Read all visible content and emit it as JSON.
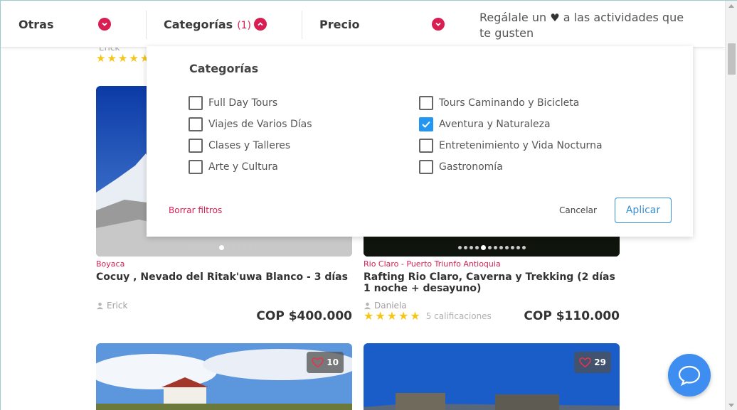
{
  "filters": {
    "others_label": "Otras",
    "categories_label": "Categorías",
    "categories_count": "(1)",
    "price_label": "Precio",
    "gift_text_before": "Regálale un",
    "gift_text_after": "a las actividades que te gusten"
  },
  "dropdown": {
    "title": "Categorías",
    "options_left": [
      {
        "label": "Full Day Tours",
        "checked": false
      },
      {
        "label": "Viajes de Varios Días",
        "checked": false
      },
      {
        "label": "Clases y Talleres",
        "checked": false
      },
      {
        "label": "Arte y Cultura",
        "checked": false
      }
    ],
    "options_right": [
      {
        "label": "Tours Caminando y Bicicleta",
        "checked": false
      },
      {
        "label": "Aventura y Naturaleza",
        "checked": true
      },
      {
        "label": "Entretenimiento y Vida Nocturna",
        "checked": false
      },
      {
        "label": "Gastronomía",
        "checked": false
      }
    ],
    "clear_label": "Borrar filtros",
    "cancel_label": "Cancelar",
    "apply_label": "Aplicar"
  },
  "peek": {
    "author": "Erick"
  },
  "cards": [
    {
      "location": "Boyaca",
      "title": "Cocuy , Nevado del Ritak'uwa Blanco - 3 días",
      "author": "Erick",
      "price": "COP $400.000",
      "dots": 12,
      "active_dot": 5
    },
    {
      "location": "Rio Claro - Puerto Triunfo Antioquia",
      "title": "Rafting Rio Claro, Caverna y Trekking (2 días 1 noche + desayuno)",
      "author": "Daniela",
      "ratings": "5 calificaciones",
      "stars": 5,
      "price": "COP $110.000",
      "dots": 12,
      "active_dot": 4
    },
    {
      "likes": "10"
    },
    {
      "likes": "29"
    }
  ],
  "colors": {
    "accent": "#d81e52",
    "primary": "#2196f3",
    "star": "#f5c518"
  },
  "icons": [
    "chevron-down-icon",
    "chevron-up-icon",
    "heart-icon",
    "user-icon",
    "star-icon",
    "checkmark-icon",
    "chat-bubble-icon"
  ]
}
